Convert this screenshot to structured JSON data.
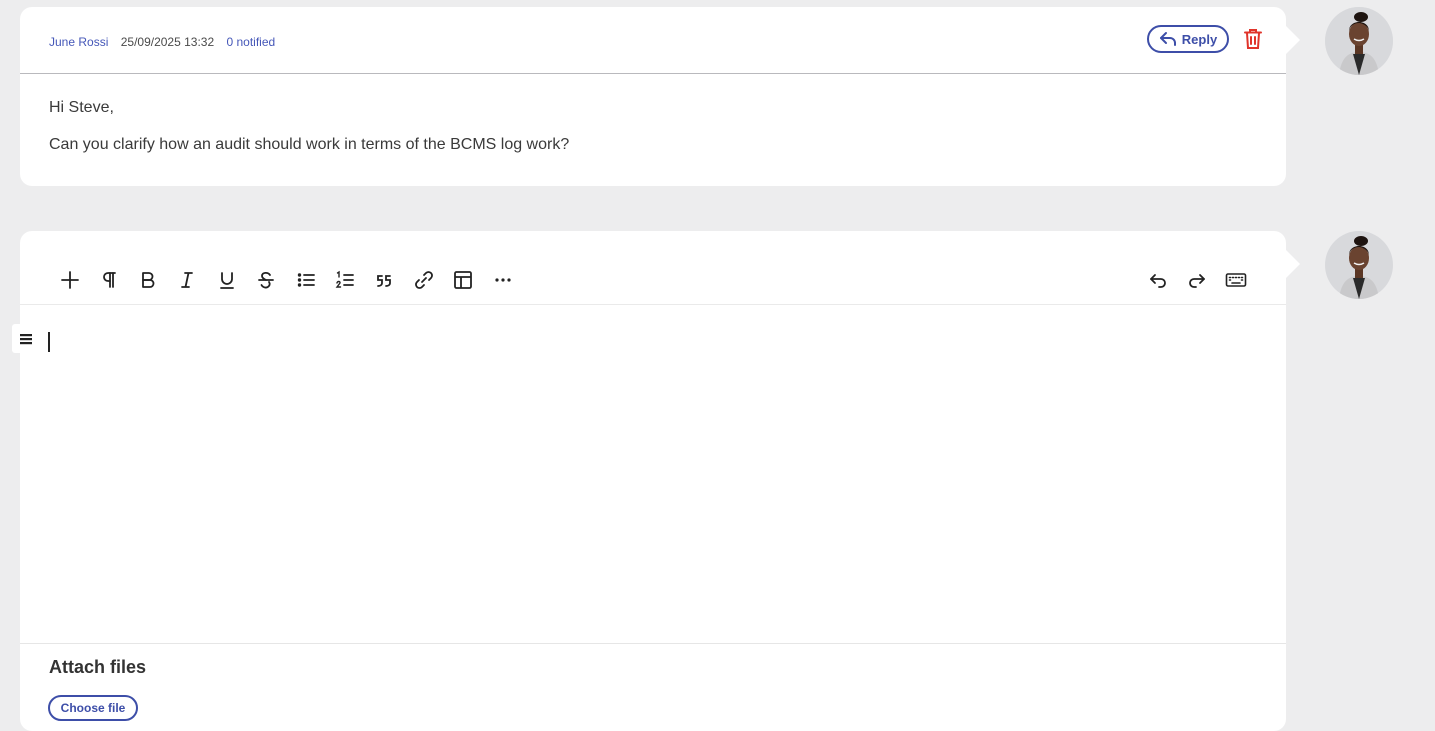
{
  "comment": {
    "author": "June Rossi",
    "timestamp": "25/09/2025 13:32",
    "notified": "0 notified",
    "reply_label": "Reply",
    "body": [
      "Hi Steve,",
      "Can you clarify how an audit should work in terms of the BCMS log work?"
    ]
  },
  "editor": {
    "toolbar_left": [
      "plus-icon",
      "paragraph-icon",
      "bold-icon",
      "italic-icon",
      "underline-icon",
      "strikethrough-icon",
      "bullet-list-icon",
      "ordered-list-icon",
      "blockquote-icon",
      "link-icon",
      "table-icon",
      "more-icon"
    ],
    "toolbar_right": [
      "undo-icon",
      "redo-icon",
      "keyboard-icon"
    ],
    "text": ""
  },
  "attachments": {
    "title": "Attach files",
    "button_label": "Choose file"
  },
  "colors": {
    "accent": "#3d4ea8",
    "delete": "#e0342b",
    "background": "#ededee"
  }
}
